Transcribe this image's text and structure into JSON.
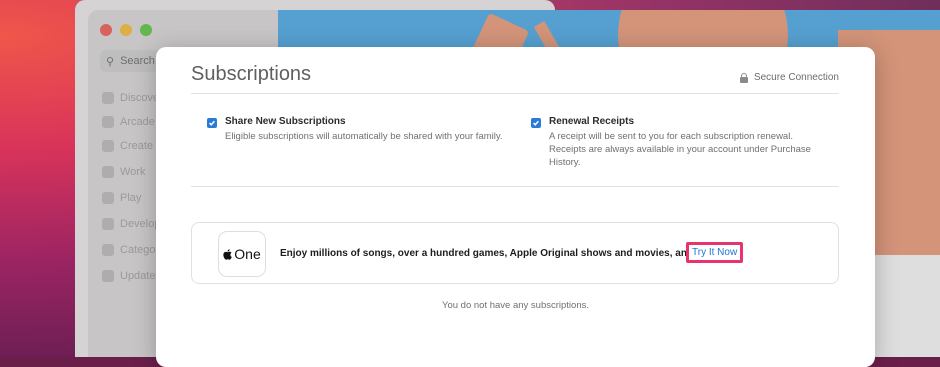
{
  "background": {
    "search_placeholder": "Search",
    "sidebar_items": [
      "Discover",
      "Arcade",
      "Create",
      "Work",
      "Play",
      "Develop",
      "Categories",
      "Updates"
    ]
  },
  "sheet": {
    "title": "Subscriptions",
    "secure_label": "Secure Connection",
    "options": [
      {
        "title": "Share New Subscriptions",
        "description": "Eligible subscriptions will automatically be shared with your family.",
        "checked": true
      },
      {
        "title": "Renewal Receipts",
        "description": "A receipt will be sent to you for each subscription renewal. Receipts are always available in your account under Purchase History.",
        "checked": true
      }
    ],
    "promo": {
      "logo_text": "One",
      "text": "Enjoy millions of songs, over a hundred games, Apple Original shows and movies, and more.",
      "link_label": "Try It Now"
    },
    "empty_message": "You do not have any subscriptions."
  },
  "colors": {
    "accent": "#2a7ad8",
    "link": "#1f73d6",
    "highlight": "#e8346e"
  }
}
